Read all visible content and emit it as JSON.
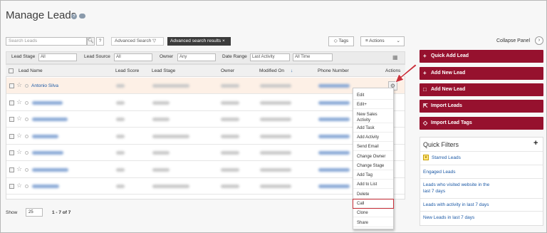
{
  "page": {
    "title": "Manage Leads"
  },
  "toolbar": {
    "search_placeholder": "Search Leads",
    "search_icon": "search-icon",
    "help": "?",
    "advanced_search": "Advanced Search",
    "advanced_results": "Advanced search results",
    "tags": "Tags",
    "actions": "Actions"
  },
  "filters": {
    "lead_stage_label": "Lead Stage",
    "lead_stage_value": "All",
    "lead_source_label": "Lead Source",
    "lead_source_value": "All",
    "owner_label": "Owner",
    "owner_value": "Any",
    "date_range_label": "Date Range",
    "date_range_field": "Last Activity",
    "date_range_value": "All Time"
  },
  "table": {
    "columns": [
      "Lead Name",
      "Lead Score",
      "Lead Stage",
      "Owner",
      "Modified On",
      "Phone Number",
      "Actions"
    ],
    "first_lead_name": "Antonio Silva"
  },
  "footer": {
    "show_label": "Show",
    "show_value": "25",
    "pager": "1 - 7 of 7"
  },
  "context_menu": {
    "items": [
      "Edit",
      "Edit+",
      "New Sales\nActivity",
      "Add Task",
      "Add Activity",
      "Send Email",
      "Change Owner",
      "Change Stage",
      "Add Tag",
      "Add to List",
      "Delete",
      "Call",
      "Clone",
      "Share"
    ],
    "highlighted": "Call"
  },
  "side_panel": {
    "collapse": "Collapse Panel",
    "buttons": [
      "Quick Add Lead",
      "Add New Lead",
      "Add New Lead",
      "Import Leads",
      "Import Lead Tags"
    ],
    "quick_filters_title": "Quick Filters",
    "quick_filters": [
      "Starred Leads",
      "Engaged Leads",
      "Leads who visited website in the\nlast 7 days",
      "Leads with activity in last 7 days",
      "New Leads in last 7 days"
    ]
  },
  "colors": {
    "brand": "#96112e",
    "highlight": "#c9323c",
    "link": "#1d5aa6"
  }
}
